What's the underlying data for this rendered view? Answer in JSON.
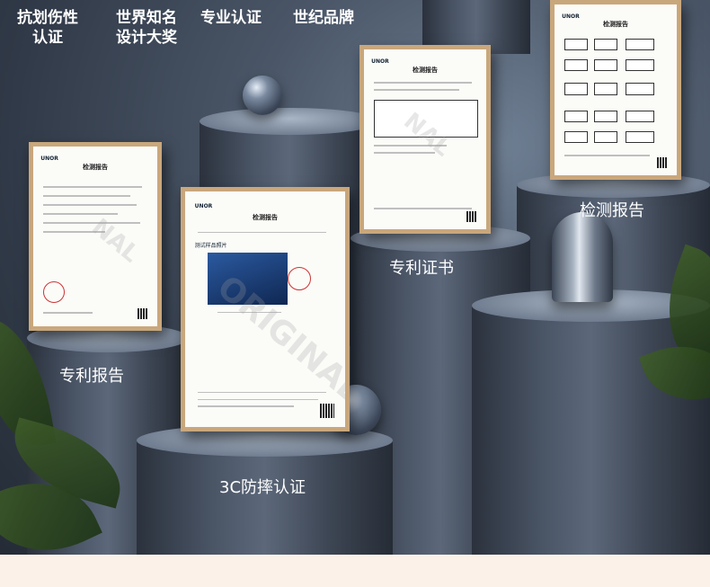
{
  "badges": [
    {
      "line1": "抗划伤性",
      "line2": "认证"
    },
    {
      "line1": "世界知名",
      "line2": "设计大奖"
    },
    {
      "line1": "专业认证",
      "line2": ""
    },
    {
      "line1": "世纪品牌",
      "line2": ""
    }
  ],
  "captions": {
    "patent_report": "专利报告",
    "drop_cert": "3C防摔认证",
    "patent_cert": "专利证书",
    "test_report": "检测报告"
  },
  "documents": {
    "doc1": {
      "brand": "UNOR",
      "title": "检测报告"
    },
    "doc2": {
      "brand": "UNOR",
      "title": "检测报告",
      "section": "测试样品照片"
    },
    "doc3": {
      "brand": "UNOR",
      "title": "检测报告"
    },
    "doc4": {
      "brand": "UNOR",
      "title": "检测报告"
    }
  },
  "colors": {
    "background": "#3b4453",
    "bottom_band": "#fbf1e8",
    "frame": "#c9a77c",
    "text": "#ffffff"
  }
}
